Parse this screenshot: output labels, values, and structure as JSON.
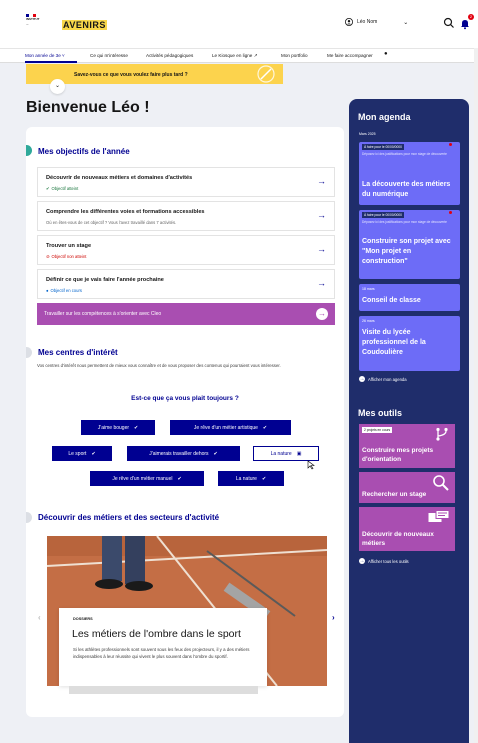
{
  "header": {
    "org_lines": [
      "INSTITUT",
      "..."
    ],
    "brand": "AVENIRS",
    "user_name": "Léo Nom"
  },
  "colors": {
    "primary": "#000091",
    "accent_yellow": "#fcd34d",
    "purple": "#a94eb1",
    "agenda_bg": "#1f2d6b",
    "event_bg": "#6d6cf7",
    "teal": "#2fa99a",
    "red": "#e1000f"
  },
  "icons": [
    "user-icon",
    "chevron-down-icon",
    "search-icon",
    "bell-icon",
    "arrow-right-icon",
    "check-icon",
    "pencil-icon",
    "magnifier-icon",
    "branch-icon",
    "chat-icon"
  ],
  "nav": {
    "items": [
      "Mon année de 3e ˅",
      "Ce qui m'intéresse",
      "Activités pédagogiques",
      "Le Kiosque en ligne ↗",
      "Mon portfolio",
      "Me faire accompagner"
    ]
  },
  "banner": {
    "text": "Savez-vous ce que vous voulez faire plus tard ?"
  },
  "welcome": "Bienvenue Léo !",
  "objectives": {
    "title": "Mes objectifs de l'année",
    "items": [
      {
        "title": "Découvrir de nouveaux métiers et domaines d'activités",
        "status": "Objectif atteint",
        "status_color": "#18753c"
      },
      {
        "title": "Comprendre les différentes voies et formations accessibles",
        "status": "Où en êtes-vous de cet objectif ? Vous l'avez travaillé dans 7 activités.",
        "status_color": "#666666"
      },
      {
        "title": "Trouver un stage",
        "status": "Objectif non atteint",
        "status_color": "#ce0500"
      },
      {
        "title": "Définir ce que je vais faire l'année prochaine",
        "status": "Objectif en cours",
        "status_color": "#0063cb"
      }
    ],
    "cta": "Travailler sur les compétences à s'orienter avec Cleo"
  },
  "interests": {
    "title": "Mes centres d'intérêt",
    "intro": "Vos centres d'intérêt nous permettent de mieux vous connaître et de vous proposer des contenus qui pourraient vous intéresser.",
    "question": "Est-ce que ça vous plait toujours ?",
    "chips": [
      "J'aime bouger",
      "Je rêve d'un métier artistique",
      "Le sport",
      "J'aimerais travailler dehors",
      "La nature",
      "Je rêve d'un métier manuel",
      "La nature"
    ]
  },
  "discover": {
    "title": "Découvrir des métiers et des secteurs d'activité",
    "kicker": "DOSSIERS",
    "article_title": "Les métiers de l'ombre dans le sport",
    "article_body": "Si les athlètes professionnels sont souvent sous les feux des projecteurs, il y a des métiers indispensables à leur réussite qui vivent le plus souvent dans l'ombre du sportif."
  },
  "agenda": {
    "title": "Mon agenda",
    "month": "Mars 2025",
    "events": [
      {
        "tag": "À faire pour le 00/00/0000",
        "small": "Déposez ici des justifications pour mon stage de découverte",
        "title": "La découverte des métiers du numérique"
      },
      {
        "tag": "À faire pour le 00/00/0000",
        "small": "Déposez ici des justifications pour mon stage de découverte",
        "title": "Construire son projet avec \"Mon projet en construction\""
      },
      {
        "tag": "18 mars",
        "small": "",
        "title": "Conseil de classe"
      },
      {
        "tag": "26 mars",
        "small": "",
        "title": "Visite du lycée professionnel de la Coudoulière"
      }
    ],
    "link": "Afficher mon agenda"
  },
  "tools": {
    "title": "Mes outils",
    "items": [
      {
        "badge": "2 projets en cours",
        "label": "Construire mes projets d'orientation"
      },
      {
        "badge": "",
        "label": "Rechercher un stage"
      },
      {
        "badge": "",
        "label": "Découvrir de nouveaux métiers"
      }
    ],
    "link": "Afficher tous les outils"
  }
}
